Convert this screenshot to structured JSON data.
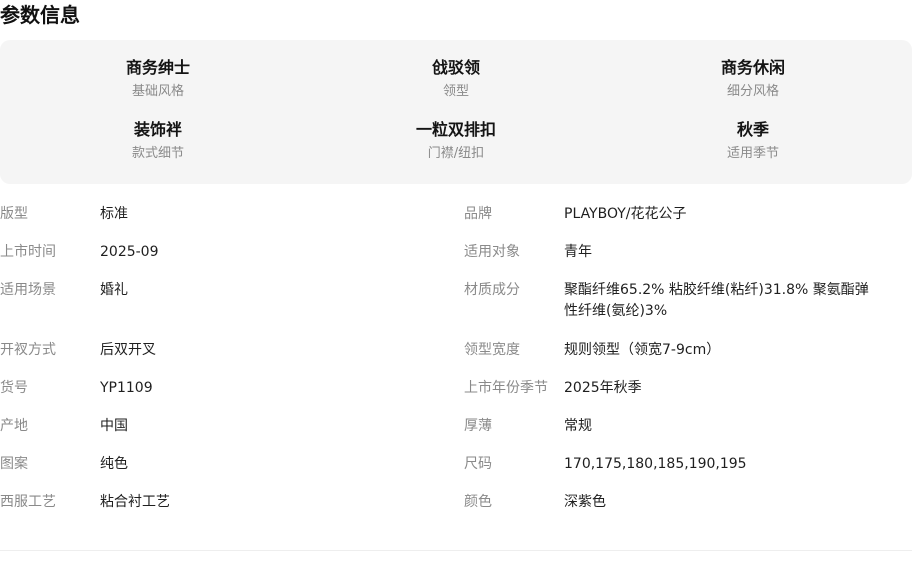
{
  "section": {
    "title": "参数信息"
  },
  "highlights": [
    {
      "value": "商务绅士",
      "label": "基础风格"
    },
    {
      "value": "戗驳领",
      "label": "领型"
    },
    {
      "value": "商务休闲",
      "label": "细分风格"
    },
    {
      "value": "装饰袢",
      "label": "款式细节"
    },
    {
      "value": "一粒双排扣",
      "label": "门襟/纽扣"
    },
    {
      "value": "秋季",
      "label": "适用季节"
    }
  ],
  "params_left": [
    {
      "key": "版型",
      "value": "标准"
    },
    {
      "key": "上市时间",
      "value": "2025-09"
    },
    {
      "key": "适用场景",
      "value": "婚礼"
    },
    {
      "key": "开衩方式",
      "value": "后双开叉"
    },
    {
      "key": "货号",
      "value": "YP1109"
    },
    {
      "key": "产地",
      "value": "中国"
    },
    {
      "key": "图案",
      "value": "纯色"
    },
    {
      "key": "西服工艺",
      "value": "粘合衬工艺"
    }
  ],
  "params_right": [
    {
      "key": "品牌",
      "value": "PLAYBOY/花花公子"
    },
    {
      "key": "适用对象",
      "value": "青年"
    },
    {
      "key": "材质成分",
      "value": "聚酯纤维65.2% 粘胶纤维(粘纤)31.8% 聚氨酯弹性纤维(氨纶)3%"
    },
    {
      "key": "领型宽度",
      "value": "规则领型（领宽7-9cm）"
    },
    {
      "key": "上市年份季节",
      "value": "2025年秋季"
    },
    {
      "key": "厚薄",
      "value": "常规"
    },
    {
      "key": "尺码",
      "value": "170,175,180,185,190,195"
    },
    {
      "key": "颜色",
      "value": "深紫色"
    }
  ],
  "colors": {
    "highlight_background": "#f5f5f5",
    "label_gray": "#8a8a8a",
    "text_dark": "#1f1f1f"
  }
}
